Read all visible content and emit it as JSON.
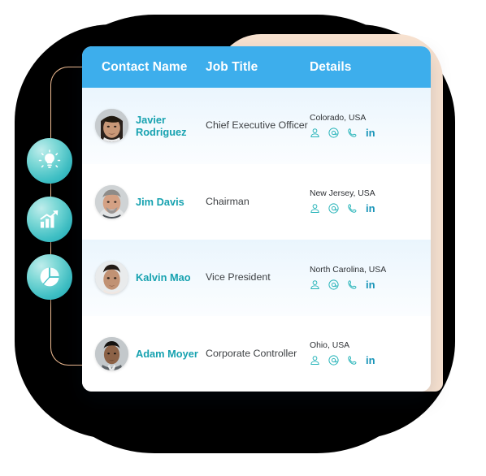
{
  "card": {
    "columns": [
      {
        "key": "name",
        "label": "Contact Name"
      },
      {
        "key": "title",
        "label": "Job Title"
      },
      {
        "key": "details",
        "label": "Details"
      }
    ],
    "rows": [
      {
        "name": "Javier Rodriguez",
        "title": "Chief Executive Officer",
        "location": "Colorado, USA",
        "actions": [
          "contact-icon",
          "email-icon",
          "phone-icon",
          "linkedin-icon"
        ],
        "linkedin_label": "in"
      },
      {
        "name": "Jim Davis",
        "title": "Chairman",
        "location": "New Jersey, USA",
        "actions": [
          "contact-icon",
          "email-icon",
          "phone-icon",
          "linkedin-icon"
        ],
        "linkedin_label": "in"
      },
      {
        "name": "Kalvin Mao",
        "title": "Vice President",
        "location": "North Carolina, USA",
        "actions": [
          "contact-icon",
          "email-icon",
          "phone-icon",
          "linkedin-icon"
        ],
        "linkedin_label": "in"
      },
      {
        "name": "Adam Moyer",
        "title": "Corporate Controller",
        "location": "Ohio, USA",
        "actions": [
          "contact-icon",
          "email-icon",
          "phone-icon",
          "linkedin-icon"
        ],
        "linkedin_label": "in"
      }
    ]
  },
  "badges": [
    {
      "icon": "lightbulb-icon"
    },
    {
      "icon": "bar-chart-growth-icon"
    },
    {
      "icon": "pie-chart-icon"
    }
  ],
  "colors": {
    "header_blue": "#3DAEEC",
    "name_teal": "#17A2B0",
    "icon_teal": "#24B3B8",
    "linkedin_blue": "#1894B8",
    "peach": "#F8E2D0",
    "connector_orange": "#F0BC93",
    "row_tint": "#EAF5FD",
    "title_gray": "#3E4144"
  }
}
